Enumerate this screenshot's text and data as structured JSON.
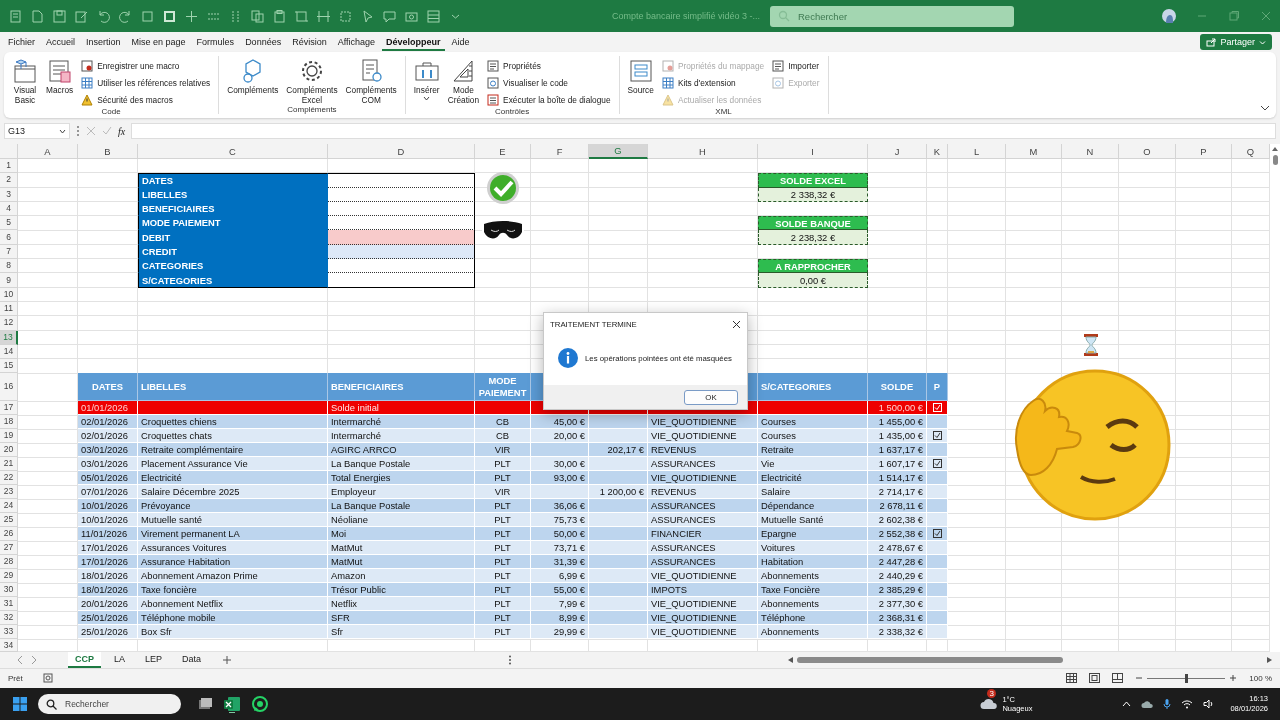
{
  "window": {
    "title": "Compte bancaire simplifié vidéo 3 -...",
    "search_placeholder": "Rechercher"
  },
  "menu_tabs": [
    {
      "label": "Fichier",
      "selected": false
    },
    {
      "label": "Accueil",
      "selected": false
    },
    {
      "label": "Insertion",
      "selected": false
    },
    {
      "label": "Mise en page",
      "selected": false
    },
    {
      "label": "Formules",
      "selected": false
    },
    {
      "label": "Données",
      "selected": false
    },
    {
      "label": "Révision",
      "selected": false
    },
    {
      "label": "Affichage",
      "selected": false
    },
    {
      "label": "Développeur",
      "selected": true
    },
    {
      "label": "Aide",
      "selected": false
    }
  ],
  "share_button": "Partager",
  "ribbon_groups": [
    {
      "label": "Code",
      "items": [
        {
          "kind": "large",
          "label": "Visual Basic",
          "disabled": false,
          "dropdown": false
        },
        {
          "kind": "large",
          "label": "Macros",
          "disabled": false,
          "dropdown": false
        },
        {
          "kind": "small",
          "label": "Enregistrer une macro",
          "disabled": false
        },
        {
          "kind": "small",
          "label": "Utiliser les références relatives",
          "disabled": false
        },
        {
          "kind": "small",
          "label": "Sécurité des macros",
          "disabled": false
        }
      ]
    },
    {
      "label": "Compléments",
      "items": [
        {
          "kind": "large",
          "label": "Compléments",
          "disabled": false,
          "dropdown": false
        },
        {
          "kind": "large",
          "label": "Compléments Excel",
          "disabled": false,
          "dropdown": false
        },
        {
          "kind": "large",
          "label": "Compléments COM",
          "disabled": false,
          "dropdown": false
        }
      ]
    },
    {
      "label": "Contrôles",
      "items": [
        {
          "kind": "large",
          "label": "Insérer",
          "disabled": false,
          "dropdown": true
        },
        {
          "kind": "large",
          "label": "Mode Création",
          "disabled": false,
          "dropdown": false
        },
        {
          "kind": "small",
          "label": "Propriétés",
          "disabled": false
        },
        {
          "kind": "small",
          "label": "Visualiser le code",
          "disabled": false
        },
        {
          "kind": "small",
          "label": "Exécuter la boîte de dialogue",
          "disabled": false
        }
      ]
    },
    {
      "label": "XML",
      "items": [
        {
          "kind": "large",
          "label": "Source",
          "disabled": false,
          "dropdown": false
        },
        {
          "kind": "small",
          "label": "Propriétés du mappage",
          "disabled": true
        },
        {
          "kind": "small",
          "label": "Kits d'extension",
          "disabled": false
        },
        {
          "kind": "small",
          "label": "Actualiser les données",
          "disabled": true
        },
        {
          "kind": "small",
          "label": "Importer",
          "disabled": false
        },
        {
          "kind": "small",
          "label": "Exporter",
          "disabled": true
        }
      ]
    }
  ],
  "formula_bar": {
    "name_box": "G13",
    "function_label": "fx"
  },
  "sheet": {
    "columns": [
      {
        "label": "A",
        "selected": false
      },
      {
        "label": "B",
        "selected": false
      },
      {
        "label": "C",
        "selected": false
      },
      {
        "label": "D",
        "selected": false
      },
      {
        "label": "E",
        "selected": false
      },
      {
        "label": "F",
        "selected": false
      },
      {
        "label": "G",
        "selected": true
      },
      {
        "label": "H",
        "selected": false
      },
      {
        "label": "I",
        "selected": false
      },
      {
        "label": "J",
        "selected": false
      },
      {
        "label": "K",
        "selected": false
      },
      {
        "label": "L",
        "selected": false
      },
      {
        "label": "M",
        "selected": false
      },
      {
        "label": "N",
        "selected": false
      },
      {
        "label": "O",
        "selected": false
      },
      {
        "label": "P",
        "selected": false
      },
      {
        "label": "Q",
        "selected": false
      }
    ],
    "rows": [
      {
        "label": "1",
        "selected": false
      },
      {
        "label": "2",
        "selected": false
      },
      {
        "label": "3",
        "selected": false
      },
      {
        "label": "4",
        "selected": false
      },
      {
        "label": "5",
        "selected": false
      },
      {
        "label": "6",
        "selected": false
      },
      {
        "label": "7",
        "selected": false
      },
      {
        "label": "8",
        "selected": false
      },
      {
        "label": "9",
        "selected": false
      },
      {
        "label": "10",
        "selected": false
      },
      {
        "label": "11",
        "selected": false
      },
      {
        "label": "12",
        "selected": false
      },
      {
        "label": "13",
        "selected": true
      },
      {
        "label": "14",
        "selected": false
      },
      {
        "label": "15",
        "selected": false
      },
      {
        "label": "16",
        "selected": false
      },
      {
        "label": "17",
        "selected": false
      },
      {
        "label": "18",
        "selected": false
      },
      {
        "label": "19",
        "selected": false
      },
      {
        "label": "20",
        "selected": false
      },
      {
        "label": "21",
        "selected": false
      },
      {
        "label": "22",
        "selected": false
      },
      {
        "label": "23",
        "selected": false
      },
      {
        "label": "24",
        "selected": false
      },
      {
        "label": "25",
        "selected": false
      },
      {
        "label": "26",
        "selected": false
      },
      {
        "label": "27",
        "selected": false
      },
      {
        "label": "28",
        "selected": false
      },
      {
        "label": "29",
        "selected": false
      },
      {
        "label": "30",
        "selected": false
      },
      {
        "label": "31",
        "selected": false
      },
      {
        "label": "32",
        "selected": false
      },
      {
        "label": "33",
        "selected": false
      },
      {
        "label": "34",
        "selected": false
      }
    ],
    "form": {
      "fields": [
        {
          "label": "DATES",
          "color": "#ffffff"
        },
        {
          "label": "LIBELLES",
          "color": "#ffffff"
        },
        {
          "label": "BENEFICIAIRES",
          "color": "#ffffff"
        },
        {
          "label": "MODE PAIEMENT",
          "color": "#ffffff"
        },
        {
          "label": "DEBIT",
          "color": "#f8cbcb"
        },
        {
          "label": "CREDIT",
          "color": "#dde8f7"
        },
        {
          "label": "CATEGORIES",
          "color": "#ffffff"
        },
        {
          "label": "S/CATEGORIES",
          "color": "#ffffff"
        }
      ]
    },
    "balances": [
      {
        "title": "SOLDE EXCEL",
        "value": "2 338,32 €"
      },
      {
        "title": "SOLDE BANQUE",
        "value": "2 238,32 €"
      },
      {
        "title": "A RAPPROCHER",
        "value": "0,00 €"
      }
    ],
    "table": {
      "headers": {
        "date": "DATES",
        "label": "LIBELLES",
        "beneficiary": "BENEFICIAIRES",
        "mode": "MODE PAIEMENT",
        "subcategory": "S/CATEGORIES",
        "balance": "SOLDE",
        "checked": "P"
      },
      "rows": [
        {
          "kind": "initial",
          "date": "01/01/2026",
          "beneficiary": "Solde initial",
          "balance": "1 500,00 €",
          "checked": true
        },
        {
          "kind": "entry",
          "date": "02/01/2026",
          "label": "Croquettes chiens",
          "beneficiary": "Intermarché",
          "mode": "CB",
          "debit": "45,00 €",
          "category": "VIE_QUOTIDIENNE",
          "subcategory": "Courses",
          "balance": "1 455,00 €",
          "checked": false
        },
        {
          "kind": "entry",
          "date": "02/01/2026",
          "label": "Croquettes chats",
          "beneficiary": "Intermarché",
          "mode": "CB",
          "debit": "20,00 €",
          "category": "VIE_QUOTIDIENNE",
          "subcategory": "Courses",
          "balance": "1 435,00 €",
          "checked": true
        },
        {
          "kind": "entry",
          "date": "03/01/2026",
          "label": "Retraite complémentaire",
          "beneficiary": "AGIRC ARRCO",
          "mode": "VIR",
          "credit": "202,17 €",
          "category": "REVENUS",
          "subcategory": "Retraite",
          "balance": "1 637,17 €",
          "checked": false
        },
        {
          "kind": "entry",
          "date": "03/01/2026",
          "label": "Placement Assurance Vie",
          "beneficiary": "La Banque Postale",
          "mode": "PLT",
          "debit": "30,00 €",
          "category": "ASSURANCES",
          "subcategory": "Vie",
          "balance": "1 607,17 €",
          "checked": true
        },
        {
          "kind": "entry",
          "date": "05/01/2026",
          "label": "Electricité",
          "beneficiary": "Total Energies",
          "mode": "PLT",
          "debit": "93,00 €",
          "category": "VIE_QUOTIDIENNE",
          "subcategory": "Electricité",
          "balance": "1 514,17 €",
          "checked": false
        },
        {
          "kind": "entry",
          "date": "07/01/2026",
          "label": "Salaire Décembre 2025",
          "beneficiary": "Employeur",
          "mode": "VIR",
          "credit": "1 200,00 €",
          "category": "REVENUS",
          "subcategory": "Salaire",
          "balance": "2 714,17 €",
          "checked": false
        },
        {
          "kind": "entry",
          "date": "10/01/2026",
          "label": "Prévoyance",
          "beneficiary": "La Banque Postale",
          "mode": "PLT",
          "debit": "36,06 €",
          "category": "ASSURANCES",
          "subcategory": "Dépendance",
          "balance": "2 678,11 €",
          "checked": false
        },
        {
          "kind": "entry",
          "date": "10/01/2026",
          "label": "Mutuelle santé",
          "beneficiary": "Néoliane",
          "mode": "PLT",
          "debit": "75,73 €",
          "category": "ASSURANCES",
          "subcategory": "Mutuelle Santé",
          "balance": "2 602,38 €",
          "checked": false
        },
        {
          "kind": "entry",
          "date": "11/01/2026",
          "label": "Virement permanent LA",
          "beneficiary": "Moi",
          "mode": "PLT",
          "debit": "50,00 €",
          "category": "FINANCIER",
          "subcategory": "Epargne",
          "balance": "2 552,38 €",
          "checked": true
        },
        {
          "kind": "entry",
          "date": "17/01/2026",
          "label": "Assurances Voitures",
          "beneficiary": "MatMut",
          "mode": "PLT",
          "debit": "73,71 €",
          "category": "ASSURANCES",
          "subcategory": "Voitures",
          "balance": "2 478,67 €",
          "checked": false
        },
        {
          "kind": "entry",
          "date": "17/01/2026",
          "label": "Assurance Habitation",
          "beneficiary": "MatMut",
          "mode": "PLT",
          "debit": "31,39 €",
          "category": "ASSURANCES",
          "subcategory": "Habitation",
          "balance": "2 447,28 €",
          "checked": false
        },
        {
          "kind": "entry",
          "date": "18/01/2026",
          "label": "Abonnement Amazon Prime",
          "beneficiary": "Amazon",
          "mode": "PLT",
          "debit": "6,99 €",
          "category": "VIE_QUOTIDIENNE",
          "subcategory": "Abonnements",
          "balance": "2 440,29 €",
          "checked": false
        },
        {
          "kind": "entry",
          "date": "18/01/2026",
          "label": "Taxe foncière",
          "beneficiary": "Trésor Public",
          "mode": "PLT",
          "debit": "55,00 €",
          "category": "IMPOTS",
          "subcategory": "Taxe Foncière",
          "balance": "2 385,29 €",
          "checked": false
        },
        {
          "kind": "entry",
          "date": "20/01/2026",
          "label": "Abonnement Netflix",
          "beneficiary": "Netflix",
          "mode": "PLT",
          "debit": "7,99 €",
          "category": "VIE_QUOTIDIENNE",
          "subcategory": "Abonnements",
          "balance": "2 377,30 €",
          "checked": false
        },
        {
          "kind": "entry",
          "date": "25/01/2026",
          "label": "Téléphone mobile",
          "beneficiary": "SFR",
          "mode": "PLT",
          "debit": "8,99 €",
          "category": "VIE_QUOTIDIENNE",
          "subcategory": "Téléphone",
          "balance": "2 368,31 €",
          "checked": false
        },
        {
          "kind": "entry",
          "date": "25/01/2026",
          "label": "Box Sfr",
          "beneficiary": "Sfr",
          "mode": "PLT",
          "debit": "29,99 €",
          "category": "VIE_QUOTIDIENNE",
          "subcategory": "Abonnements",
          "balance": "2 338,32 €",
          "checked": false
        }
      ]
    }
  },
  "dialog": {
    "title": "TRAITEMENT TERMINE",
    "message": "Les opérations pointées ont été masquées",
    "button": "OK"
  },
  "sheet_tabs": [
    {
      "label": "CCP",
      "selected": true
    },
    {
      "label": "LA",
      "selected": false
    },
    {
      "label": "LEP",
      "selected": false
    },
    {
      "label": "Data",
      "selected": false
    }
  ],
  "status_bar": {
    "text": "Prêt",
    "zoom": "100 %",
    "zoom_slider": {
      "level": 0.5
    }
  },
  "taskbar": {
    "search_placeholder": "Rechercher",
    "notification_count": "3",
    "temperature": "1°C",
    "weather": "Nuageux",
    "time": "16:13",
    "date": "08/01/2026"
  }
}
